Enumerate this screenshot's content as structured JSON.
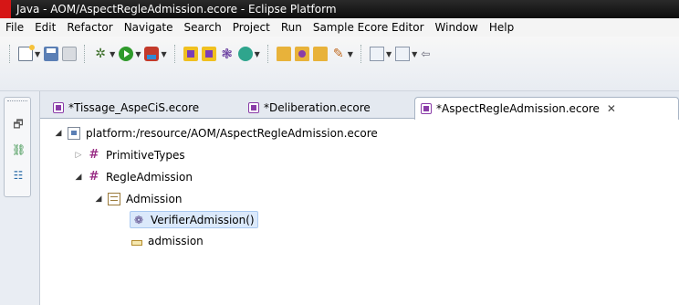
{
  "window": {
    "title": "Java - AOM/AspectRegleAdmission.ecore - Eclipse Platform"
  },
  "menu": {
    "items": [
      "File",
      "Edit",
      "Refactor",
      "Navigate",
      "Search",
      "Project",
      "Run",
      "Sample Ecore Editor",
      "Window",
      "Help"
    ]
  },
  "toolbar": {
    "icons": [
      "new-icon",
      "save-icon",
      "print-icon",
      "debug-icon",
      "run-icon",
      "external-tools-icon",
      "ecore-model-icon",
      "ecore-diagram-icon",
      "gear-icon",
      "generator-icon",
      "open-folder-icon",
      "open-package-icon",
      "folder-icon",
      "pen-icon",
      "back-icon",
      "forward-icon",
      "next-icon"
    ]
  },
  "editor": {
    "tabs": [
      {
        "label": "*Tissage_AspeCiS.ecore",
        "active": false
      },
      {
        "label": "*Deliberation.ecore",
        "active": false
      },
      {
        "label": "*AspectRegleAdmission.ecore",
        "active": true,
        "close": "✕"
      }
    ],
    "tree": {
      "root": "platform:/resource/AOM/AspectRegleAdmission.ecore",
      "nodes": [
        {
          "label": "PrimitiveTypes",
          "icon": "package-icon",
          "expanded": false
        },
        {
          "label": "RegleAdmission",
          "icon": "package-icon",
          "expanded": true
        },
        {
          "label": "Admission",
          "icon": "class-icon",
          "expanded": true
        },
        {
          "label": "VerifierAdmission()",
          "icon": "operation-icon",
          "selected": true
        },
        {
          "label": "admission",
          "icon": "attribute-icon"
        }
      ]
    }
  },
  "colors": {
    "titlebar": "#111111",
    "app_icon": "#d61616",
    "selection": "#dbe9fb",
    "package": "#9a2f86"
  }
}
